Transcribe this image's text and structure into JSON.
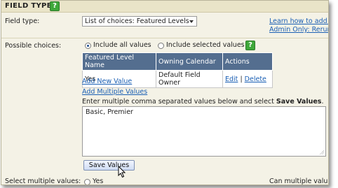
{
  "header": {
    "title": "FIELD TYPE",
    "help_icon": "?"
  },
  "field_type": {
    "label": "Field type:",
    "selected": "List of choices: Featured Levels",
    "learn_link": "Learn how to add ic",
    "admin_link": "Admin Only: Rerun"
  },
  "possible_choices": {
    "label": "Possible choices:",
    "include_all": "Include all values",
    "include_selected": "Include selected values",
    "help_icon": "?"
  },
  "values_table": {
    "headers": [
      "Featured Level Name",
      "Owning Calendar",
      "Actions"
    ],
    "rows": [
      {
        "name": "Yes",
        "calendar": "Default Field Owner",
        "edit": "Edit",
        "separator": "|",
        "delete": "Delete"
      }
    ]
  },
  "links": {
    "add_new": "Add New Value",
    "add_multiple": "Add Multiple Values"
  },
  "instructions": {
    "text": "Enter multiple comma separated values below and select ",
    "bold": "Save Values",
    "end": "."
  },
  "textarea_value": "Basic, Premier",
  "save_button": "Save Values",
  "bottom": {
    "select_multiple": "Select multiple values:",
    "yes": "Yes",
    "can_multiple": "Can multiple valu"
  }
}
